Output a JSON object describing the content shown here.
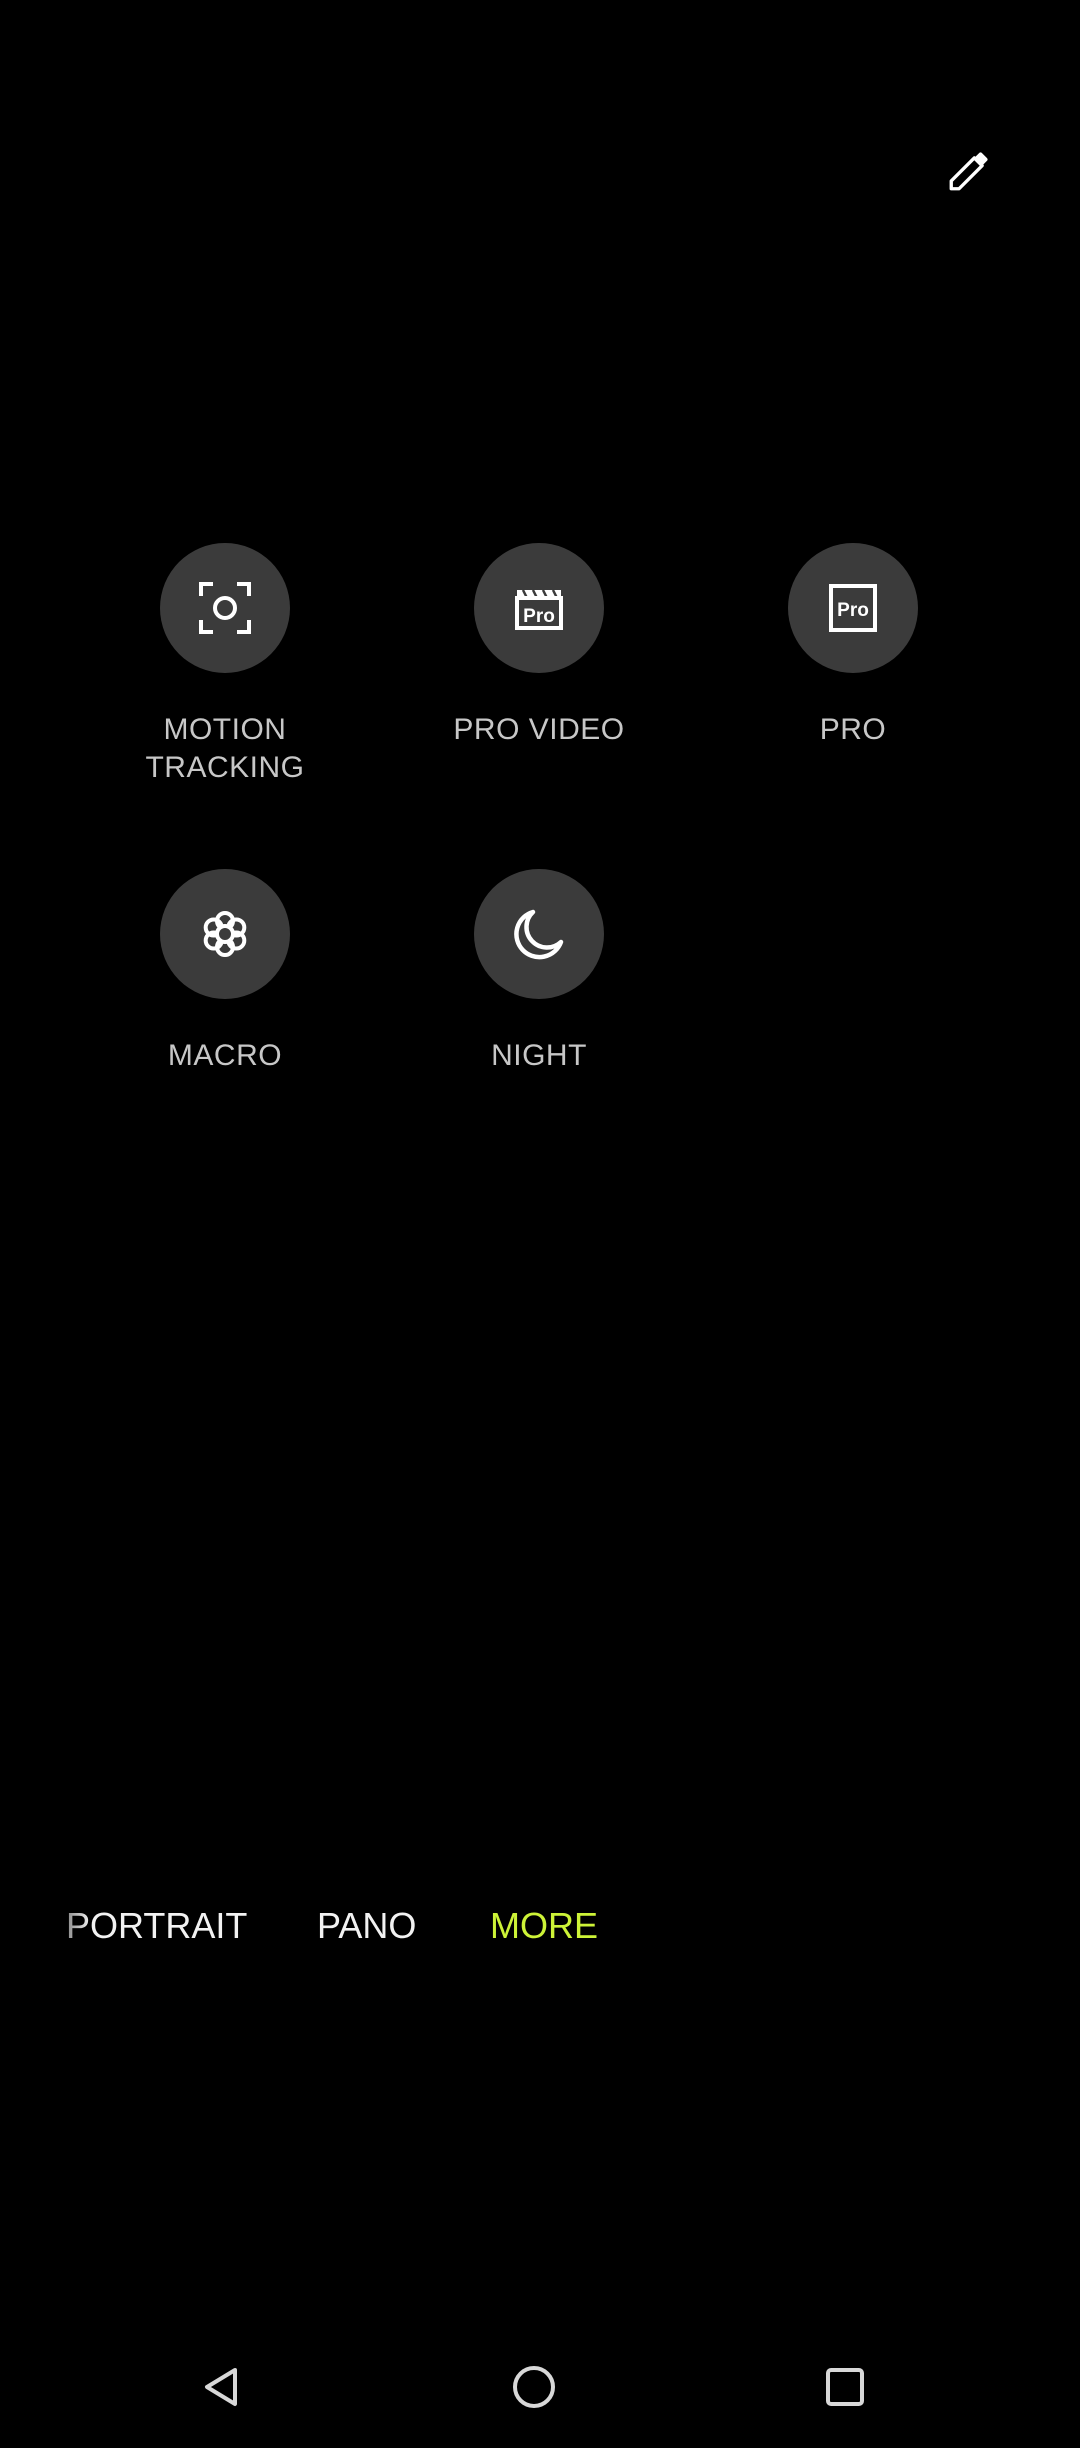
{
  "header": {
    "edit_icon": "pencil-icon"
  },
  "modes": [
    {
      "label": "MOTION\nTRACKING",
      "icon": "motion-tracking-icon"
    },
    {
      "label": "PRO VIDEO",
      "icon": "pro-video-icon"
    },
    {
      "label": "PRO",
      "icon": "pro-icon"
    },
    {
      "label": "MACRO",
      "icon": "flower-icon"
    },
    {
      "label": "NIGHT",
      "icon": "moon-icon"
    }
  ],
  "mode_strip": {
    "items": [
      "PORTRAIT",
      "PANO",
      "MORE"
    ],
    "active": "MORE"
  },
  "colors": {
    "background": "#000000",
    "circle": "#3b3b3b",
    "accent": "#cdf337",
    "label": "#c7c7c7"
  },
  "nav": {
    "back_icon": "back-triangle-icon",
    "home_icon": "home-circle-icon",
    "recents_icon": "recents-square-icon"
  }
}
